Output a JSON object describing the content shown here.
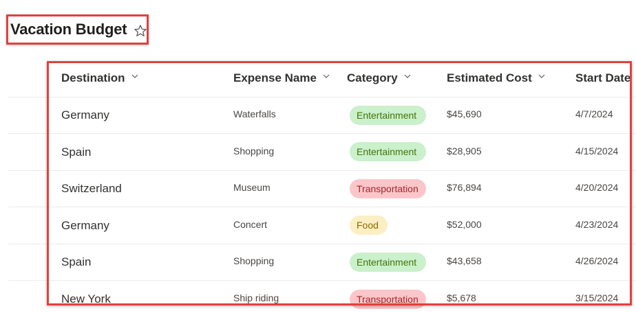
{
  "list": {
    "title": "Vacation Budget",
    "favorite_icon": "star-outline-icon"
  },
  "table": {
    "columns": [
      {
        "label": "Destination"
      },
      {
        "label": "Expense Name"
      },
      {
        "label": "Category"
      },
      {
        "label": "Estimated Cost"
      },
      {
        "label": "Start Date"
      }
    ],
    "rows": [
      {
        "destination": "Germany",
        "expense": "Waterfalls",
        "category": "Entertainment",
        "cost": "$45,690",
        "start": "4/7/2024"
      },
      {
        "destination": "Spain",
        "expense": "Shopping",
        "category": "Entertainment",
        "cost": "$28,905",
        "start": "4/15/2024"
      },
      {
        "destination": "Switzerland",
        "expense": "Museum",
        "category": "Transportation",
        "cost": "$76,894",
        "start": "4/20/2024"
      },
      {
        "destination": "Germany",
        "expense": "Concert",
        "category": "Food",
        "cost": "$52,000",
        "start": "4/23/2024"
      },
      {
        "destination": "Spain",
        "expense": "Shopping",
        "category": "Entertainment",
        "cost": "$43,658",
        "start": "4/26/2024"
      },
      {
        "destination": "New York",
        "expense": "Ship riding",
        "category": "Transportation",
        "cost": "$5,678",
        "start": "3/15/2024"
      }
    ]
  },
  "colors": {
    "highlight_border": "#e0413f",
    "entertainment_bg": "#caf0cc",
    "transportation_bg": "#fbc6c9",
    "food_bg": "#fcefc4"
  }
}
